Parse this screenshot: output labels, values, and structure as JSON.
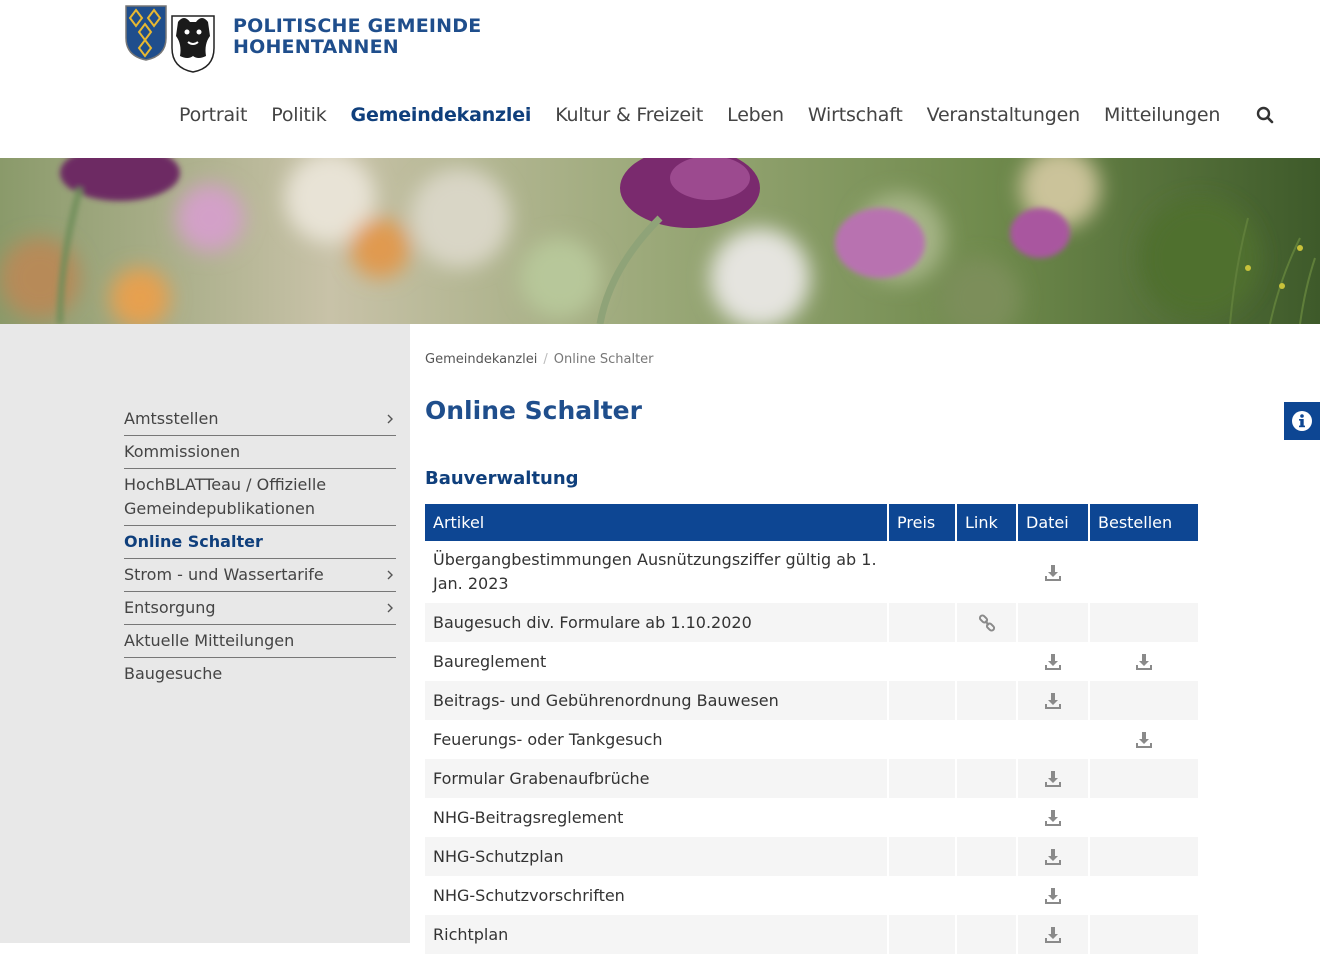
{
  "header": {
    "logo_line1": "POLITISCHE GEMEINDE",
    "logo_line2": "HOHENTANNEN",
    "brand_color": "#1f4e8c"
  },
  "nav": {
    "items": [
      {
        "label": "Portrait"
      },
      {
        "label": "Politik"
      },
      {
        "label": "Gemeindekanzlei",
        "active": true
      },
      {
        "label": "Kultur & Freizeit"
      },
      {
        "label": "Leben"
      },
      {
        "label": "Wirtschaft"
      },
      {
        "label": "Veranstaltungen"
      },
      {
        "label": "Mitteilungen"
      }
    ],
    "search_icon": "search-icon"
  },
  "sidebar": {
    "items": [
      {
        "label": "Amtsstellen",
        "has_children": true
      },
      {
        "label": "Kommissionen"
      },
      {
        "label": "HochBLATTeau / Offizielle Gemeindepublikationen"
      },
      {
        "label": "Online Schalter",
        "active": true
      },
      {
        "label": "Strom - und Wassertarife",
        "has_children": true
      },
      {
        "label": "Entsorgung",
        "has_children": true
      },
      {
        "label": "Aktuelle Mitteilungen"
      },
      {
        "label": "Baugesuche"
      }
    ]
  },
  "breadcrumb": {
    "parent": "Gemeindekanzlei",
    "separator": "/",
    "current": "Online Schalter"
  },
  "page": {
    "title": "Online Schalter",
    "section": "Bauverwaltung"
  },
  "table": {
    "headers": {
      "artikel": "Artikel",
      "preis": "Preis",
      "link": "Link",
      "datei": "Datei",
      "bestellen": "Bestellen"
    },
    "header_color": "#0d4693",
    "rows": [
      {
        "artikel": "Übergangbestimmungen Ausnützungsziffer gültig ab 1. Jan. 2023",
        "link": false,
        "datei": true,
        "bestellen": false
      },
      {
        "artikel": "Baugesuch div. Formulare ab 1.10.2020",
        "link": true,
        "datei": false,
        "bestellen": false
      },
      {
        "artikel": "Baureglement",
        "link": false,
        "datei": true,
        "bestellen": true
      },
      {
        "artikel": "Beitrags- und Gebührenordnung Bauwesen",
        "link": false,
        "datei": true,
        "bestellen": false
      },
      {
        "artikel": "Feuerungs- oder Tankgesuch",
        "link": false,
        "datei": false,
        "bestellen": true
      },
      {
        "artikel": "Formular Grabenaufbrüche",
        "link": false,
        "datei": true,
        "bestellen": false
      },
      {
        "artikel": "NHG-Beitragsreglement",
        "link": false,
        "datei": true,
        "bestellen": false
      },
      {
        "artikel": "NHG-Schutzplan",
        "link": false,
        "datei": true,
        "bestellen": false
      },
      {
        "artikel": "NHG-Schutzvorschriften",
        "link": false,
        "datei": true,
        "bestellen": false
      },
      {
        "artikel": "Richtplan",
        "link": false,
        "datei": true,
        "bestellen": false
      }
    ]
  },
  "info_tab": {
    "icon": "info-icon"
  }
}
